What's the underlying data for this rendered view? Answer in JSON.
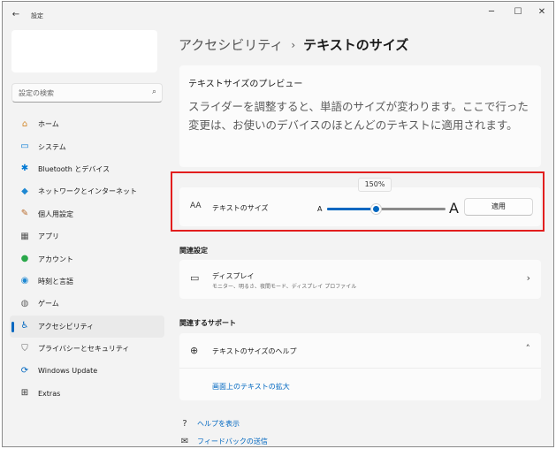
{
  "window": {
    "app_title": "設定",
    "back_glyph": "←",
    "minimize_glyph": "─",
    "maximize_glyph": "☐",
    "close_glyph": "✕"
  },
  "search": {
    "placeholder": "設定の検索",
    "icon": "search-icon",
    "glyph": "⌕"
  },
  "sidebar": {
    "items": [
      {
        "label": "ホーム",
        "icon": "home-icon",
        "glyph": "⌂",
        "color": "#d48a2e"
      },
      {
        "label": "システム",
        "icon": "system-icon",
        "glyph": "▭",
        "color": "#0078d4"
      },
      {
        "label": "Bluetooth とデバイス",
        "icon": "bluetooth-icon",
        "glyph": "✱",
        "color": "#0078d4"
      },
      {
        "label": "ネットワークとインターネット",
        "icon": "wifi-icon",
        "glyph": "◆",
        "color": "#1e88d2"
      },
      {
        "label": "個人用設定",
        "icon": "brush-icon",
        "glyph": "✎",
        "color": "#b86a2a"
      },
      {
        "label": "アプリ",
        "icon": "apps-icon",
        "glyph": "▦",
        "color": "#555555"
      },
      {
        "label": "アカウント",
        "icon": "account-icon",
        "glyph": "●",
        "color": "#2aa84a"
      },
      {
        "label": "時刻と言語",
        "icon": "clock-globe-icon",
        "glyph": "◉",
        "color": "#1e88d2"
      },
      {
        "label": "ゲーム",
        "icon": "game-controller-icon",
        "glyph": "◍",
        "color": "#666666"
      },
      {
        "label": "アクセシビリティ",
        "icon": "accessibility-icon",
        "glyph": "♿",
        "color": "#0067c0"
      },
      {
        "label": "プライバシーとセキュリティ",
        "icon": "shield-icon",
        "glyph": "⛉",
        "color": "#666666"
      },
      {
        "label": "Windows Update",
        "icon": "update-icon",
        "glyph": "⟳",
        "color": "#0067c0"
      },
      {
        "label": "Extras",
        "icon": "extras-icon",
        "glyph": "⊞",
        "color": "#333333"
      }
    ],
    "active_index": 9
  },
  "breadcrumb": {
    "parent": "アクセシビリティ",
    "separator": "›",
    "current": "テキストのサイズ"
  },
  "preview": {
    "title": "テキストサイズのプレビュー",
    "text": "スライダーを調整すると、単語のサイズが変わります。ここで行った変更は、お使いのデバイスのほとんどのテキストに適用されます。"
  },
  "text_size": {
    "icon": "text-size-icon",
    "icon_glyph": "AA",
    "label": "テキストのサイズ",
    "value_label": "150%",
    "slider_fraction": 0.41,
    "small_a": "A",
    "large_a": "A",
    "apply_label": "適用"
  },
  "related": {
    "heading": "関連設定",
    "display_title": "ディスプレイ",
    "display_subtitle": "モニター、明るさ、夜間モード、ディスプレイ プロファイル",
    "display_icon": "monitor-icon",
    "display_glyph": "▭",
    "chevron": "›"
  },
  "support": {
    "heading": "関連するサポート",
    "help_title": "テキストのサイズのヘルプ",
    "help_icon": "globe-icon",
    "help_glyph": "⊕",
    "chevron": "˄",
    "link": "画面上のテキストの拡大"
  },
  "footer": {
    "help_label": "ヘルプを表示",
    "help_icon": "help-chat-icon",
    "help_glyph": "?",
    "feedback_label": "フィードバックの送信",
    "feedback_icon": "feedback-icon",
    "feedback_glyph": "✉"
  },
  "colors": {
    "accent": "#0067c0",
    "highlight_box": "#e21e1e"
  }
}
